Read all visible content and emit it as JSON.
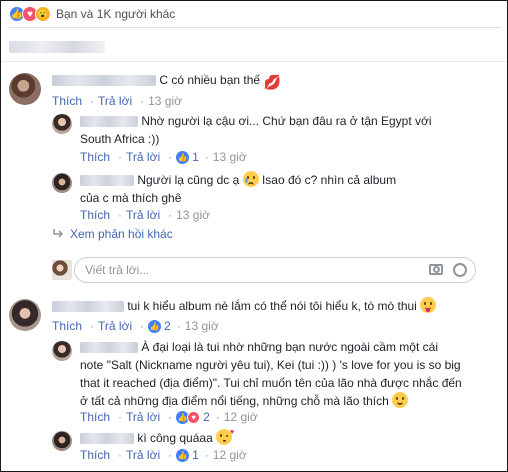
{
  "reactions": {
    "icons": [
      "like-icon",
      "love-icon",
      "wow-icon"
    ],
    "summary": "Bạn và 1K người khác"
  },
  "comments": [
    {
      "text": "C có nhiều bạn thế",
      "emoji": "kiss-lips-emoji",
      "actions": {
        "like": "Thích",
        "reply": "Trả lời",
        "time": "13 giờ"
      }
    },
    {
      "text_line1": "Nhờ người lạ cậu ơi... Chứ bạn đâu ra ở tận Egypt với",
      "text_line2": "South Africa :))",
      "actions": {
        "like": "Thích",
        "reply": "Trả lời",
        "likes": "1",
        "time": "13 giờ"
      }
    },
    {
      "text_part1": "Người lạ cũng dc ạ",
      "emoji": "disappointed-relieved-emoji",
      "text_part2": " Isao đó c? nhìn cả album",
      "text_line2": "của c mà thích ghê",
      "actions": {
        "like": "Thích",
        "reply": "Trả lời",
        "time": "13 giờ"
      }
    },
    {
      "text": "tui k hiểu album nè lắm có thể nói tôi hiểu k, tò mò thui",
      "emoji": "tongue-emoji",
      "actions": {
        "like": "Thích",
        "reply": "Trả lời",
        "likes": "2",
        "time": "13 giờ"
      }
    },
    {
      "text_line1": "À đại loại là tui nhờ những bạn nước ngoài cầm một cái",
      "text_line2": "note \"Salt (Nickname người yêu tui), Kei (tui :)) ) 's love for you is so big",
      "text_line3": "that it reached (địa điểm)\". Tui chỉ muốn tên của lão nhà được nhắc đến",
      "text_line4": "ở tất cả những địa điểm nổi tiếng, những chỗ mà lão thích",
      "emoji": "smile-emoji",
      "actions": {
        "like": "Thích",
        "reply": "Trả lời",
        "likes": "2",
        "time": "12 giờ"
      }
    },
    {
      "text": "kì công quáaa",
      "emoji": "kiss-heart-emoji",
      "actions": {
        "like": "Thích",
        "reply": "Trả lời",
        "likes": "1",
        "time": "12 giờ"
      }
    }
  ],
  "more_replies": "Xem phản hồi khác",
  "reply_box": {
    "placeholder": "Viết trả lời...",
    "icons": [
      "camera-icon",
      "emoji-icon"
    ]
  }
}
